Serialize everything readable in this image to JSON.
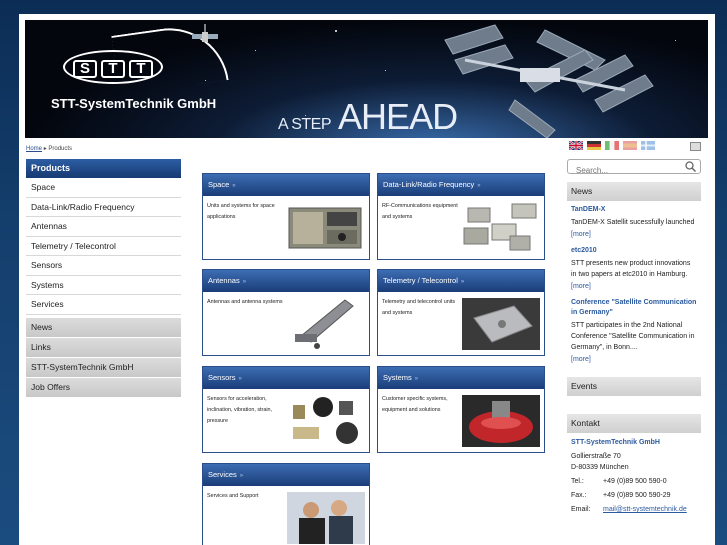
{
  "header": {
    "logo_letters": [
      "S",
      "T",
      "T"
    ],
    "company_name": "STT-SystemTechnik GmbH",
    "tagline_small": "A STEP",
    "tagline_big": "AHEAD"
  },
  "breadcrumb": {
    "home": "Home",
    "current": "Products"
  },
  "languages": [
    "english-flag",
    "german-flag",
    "italian-flag",
    "spanish-flag",
    "finnish-flag"
  ],
  "search": {
    "placeholder": "Search..."
  },
  "sidebar": {
    "header": "Products",
    "sub_items": [
      "Space",
      "Data-Link/Radio Frequency",
      "Antennas",
      "Telemetry / Telecontrol",
      "Sensors",
      "Systems",
      "Services"
    ],
    "main_items": [
      "News",
      "Links",
      "STT-SystemTechnik GmbH",
      "Job Offers"
    ]
  },
  "tiles": [
    {
      "title": "Space",
      "desc": "Units and systems for space applications"
    },
    {
      "title": "Data-Link/Radio Frequency",
      "desc": "RF-Communications equipment and systems"
    },
    {
      "title": "Antennas",
      "desc": "Antennas and antenna systems"
    },
    {
      "title": "Telemetry / Telecontrol",
      "desc": "Telemetry and telecontrol units and systems"
    },
    {
      "title": "Sensors",
      "desc": "Sensors for acceleration, inclination, vibration, strain, pressure"
    },
    {
      "title": "Systems",
      "desc": "Customer specific systems, equipment and solutions"
    },
    {
      "title": "Services",
      "desc": "Services and Support"
    }
  ],
  "tile_arrow": "»",
  "news": {
    "heading": "News",
    "items": [
      {
        "title": "TanDEM-X",
        "text": "TanDEM-X Satellit sucessfully launched",
        "more": "[more]"
      },
      {
        "title": "etc2010",
        "text": "STT presents new product innovations in two papers at etc2010 in Hamburg.",
        "more": "[more]"
      },
      {
        "title": "Conference \"Satellite Communication in Germany\"",
        "text": "STT participates in the 2nd National Conference \"Satellite Communication in Germany\", in Bonn....",
        "more": "[more]"
      }
    ]
  },
  "events": {
    "heading": "Events"
  },
  "kontakt": {
    "heading": "Kontakt",
    "company": "STT-SystemTechnik GmbH",
    "street": "Gollierstraße 70",
    "city": "D-80339 München",
    "tel_label": "Tel.:",
    "tel": "+49 (0)89 500 590-0",
    "fax_label": "Fax.:",
    "fax": "+49 (0)89 500 590-29",
    "email_label": "Email:",
    "email": "mail@stt-systemtechnik.de"
  }
}
